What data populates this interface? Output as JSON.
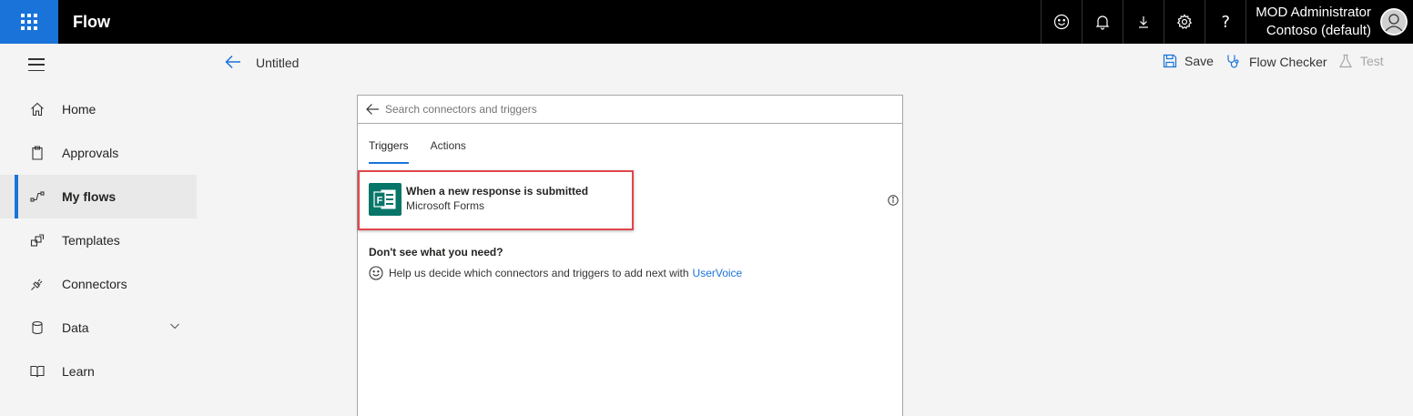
{
  "topbar": {
    "app_name": "Flow",
    "user_name": "MOD Administrator",
    "user_org": "Contoso (default)",
    "icons": [
      "smiley-icon",
      "bell-icon",
      "download-icon",
      "gear-icon",
      "help-icon"
    ]
  },
  "commandbar": {
    "title": "Untitled",
    "save_label": "Save",
    "flow_checker_label": "Flow Checker",
    "test_label": "Test"
  },
  "nav": {
    "items": [
      {
        "label": "Home",
        "icon": "home-icon"
      },
      {
        "label": "Approvals",
        "icon": "clipboard-icon"
      },
      {
        "label": "My flows",
        "icon": "flow-icon"
      },
      {
        "label": "Templates",
        "icon": "templates-icon"
      },
      {
        "label": "Connectors",
        "icon": "plug-icon"
      },
      {
        "label": "Data",
        "icon": "database-icon"
      },
      {
        "label": "Learn",
        "icon": "book-icon"
      }
    ],
    "active": "My flows"
  },
  "designer": {
    "search_placeholder": "Search connectors and triggers",
    "tabs": [
      "Triggers",
      "Actions"
    ],
    "active_tab": "Triggers",
    "trigger_title": "When a new response is submitted",
    "trigger_connector": "Microsoft Forms",
    "help_heading": "Don't see what you need?",
    "help_text": "Help us decide which connectors and triggers to add next with",
    "help_link": "UserVoice"
  },
  "colors": {
    "accent": "#1a73d9",
    "forms_green": "#077568",
    "highlight_red": "#e0474c"
  }
}
